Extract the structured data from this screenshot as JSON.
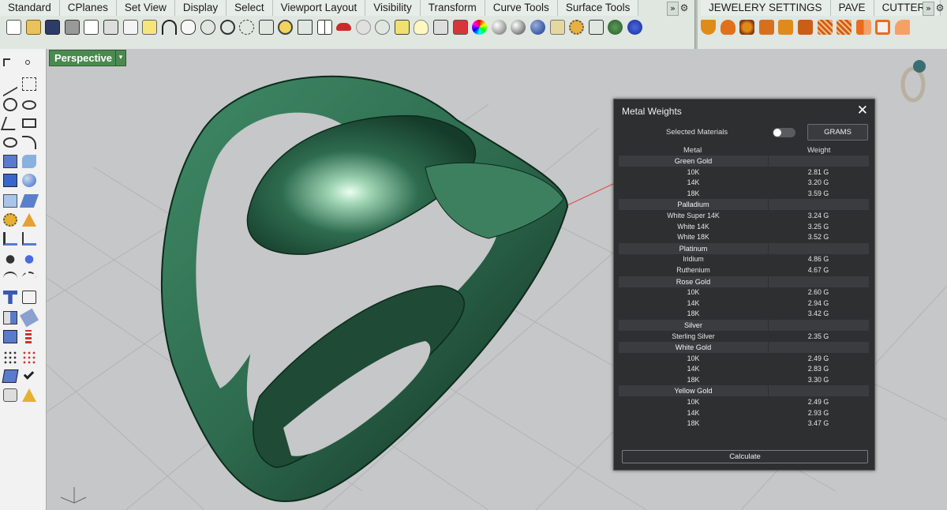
{
  "toolbar": {
    "tabs_left": [
      "Standard",
      "CPlanes",
      "Set View",
      "Display",
      "Select",
      "Viewport Layout",
      "Visibility",
      "Transform",
      "Curve Tools",
      "Surface Tools"
    ],
    "tabs_right": [
      "JEWELERY SETTINGS",
      "PAVE",
      "CUTTERS"
    ],
    "overflow_glyph": "»",
    "gear_glyph": "⚙"
  },
  "viewport": {
    "name": "Perspective",
    "dropdown_glyph": "▾"
  },
  "panel": {
    "title": "Metal Weights",
    "close_glyph": "✕",
    "selected_label": "Selected Materials",
    "toggle_on": false,
    "unit_button": "GRAMS",
    "col_metal": "Metal",
    "col_weight": "Weight",
    "groups": [
      {
        "name": "Green Gold",
        "rows": [
          {
            "metal": "10K",
            "weight": "2.81 G"
          },
          {
            "metal": "14K",
            "weight": "3.20 G"
          },
          {
            "metal": "18K",
            "weight": "3.59 G"
          }
        ]
      },
      {
        "name": "Palladium",
        "rows": [
          {
            "metal": "White Super 14K",
            "weight": "3.24 G"
          },
          {
            "metal": "White 14K",
            "weight": "3.25 G"
          },
          {
            "metal": "White 18K",
            "weight": "3.52 G"
          }
        ]
      },
      {
        "name": "Platinum",
        "rows": [
          {
            "metal": "Iridium",
            "weight": "4.86 G"
          },
          {
            "metal": "Ruthenium",
            "weight": "4.67 G"
          }
        ]
      },
      {
        "name": "Rose Gold",
        "rows": [
          {
            "metal": "10K",
            "weight": "2.60 G"
          },
          {
            "metal": "14K",
            "weight": "2.94 G"
          },
          {
            "metal": "18K",
            "weight": "3.42 G"
          }
        ]
      },
      {
        "name": "Silver",
        "rows": [
          {
            "metal": "Sterling Silver",
            "weight": "2.35 G"
          }
        ]
      },
      {
        "name": "White Gold",
        "rows": [
          {
            "metal": "10K",
            "weight": "2.49 G"
          },
          {
            "metal": "14K",
            "weight": "2.83 G"
          },
          {
            "metal": "18K",
            "weight": "3.30 G"
          }
        ]
      },
      {
        "name": "Yellow Gold",
        "rows": [
          {
            "metal": "10K",
            "weight": "2.49 G"
          },
          {
            "metal": "14K",
            "weight": "2.93 G"
          },
          {
            "metal": "18K",
            "weight": "3.47 G"
          }
        ]
      }
    ],
    "calculate_button": "Calculate"
  },
  "colors": {
    "ring": "#2e6b4f",
    "panel_bg": "#2e2f31",
    "viewport_bg": "#c6c7c8",
    "viewport_tab": "#4a8a4f"
  }
}
